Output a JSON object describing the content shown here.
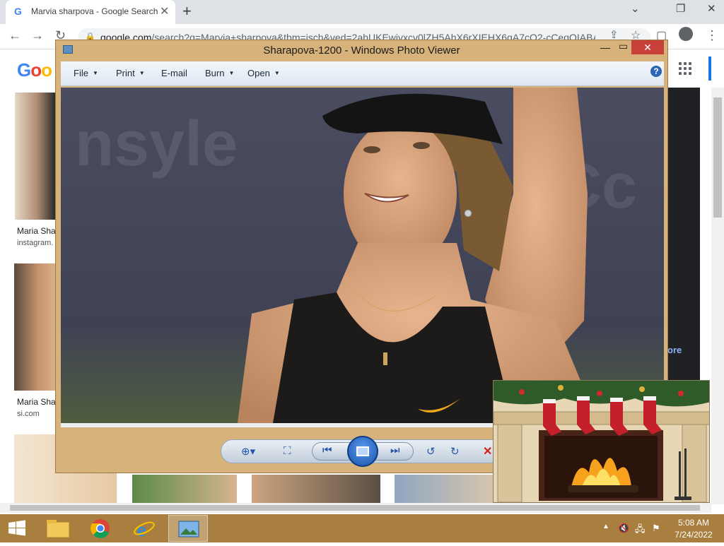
{
  "browser": {
    "tab_title": "Marvia sharpova - Google Search",
    "url_host": "google.com",
    "url_rest": "/search?q=Marvia+sharpova&tbm=isch&ved=2ahUKEwjvxcv0lZH5AhX6rXIEHX6gA7cQ2-cCegQIABA"
  },
  "google": {
    "logo": "Goo",
    "results": [
      {
        "caption": "Maria Sha",
        "source": "instagram."
      },
      {
        "caption": "Maria Sha",
        "source": "si.com"
      }
    ],
    "more_link": "ore"
  },
  "photo_viewer": {
    "title": "Sharapova-1200 - Windows Photo Viewer",
    "menu": [
      "File",
      "Print",
      "E-mail",
      "Burn",
      "Open"
    ],
    "help": "?"
  },
  "taskbar": {
    "time": "5:08 AM",
    "date": "7/24/2022"
  },
  "colors": {
    "taskbar": "#a87f3e",
    "window_frame": "#d7b27a",
    "close_red": "#c7403a",
    "google_blue": "#4285f4",
    "google_red": "#ea4335",
    "google_yellow": "#fbbc05"
  }
}
